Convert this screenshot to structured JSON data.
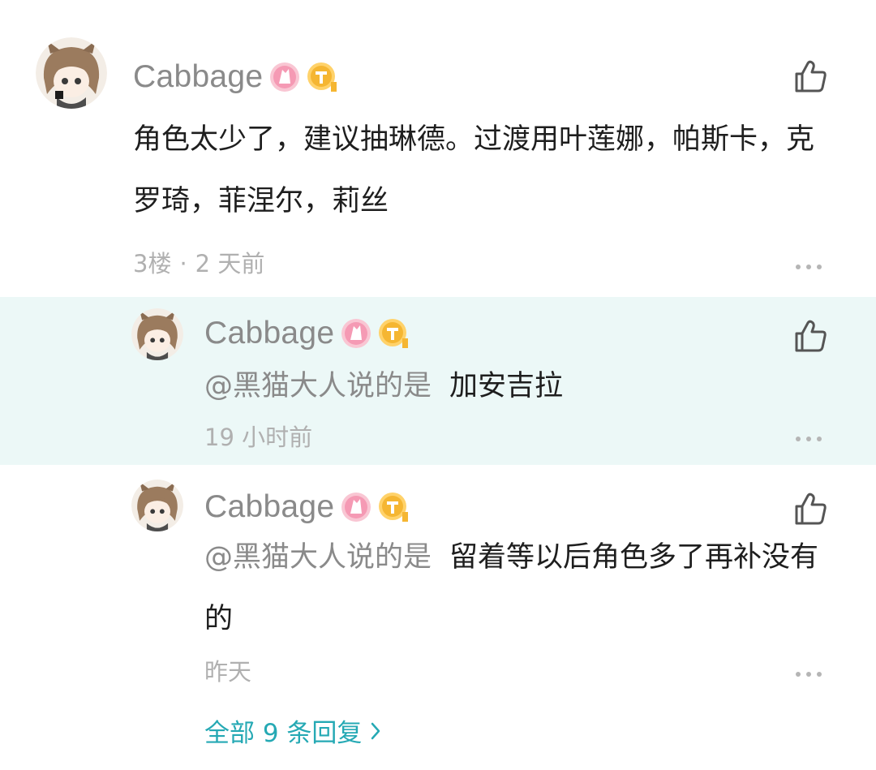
{
  "comments": [
    {
      "username": "Cabbage",
      "content": "角色太少了，建议抽琳德。过渡用叶莲娜，帕斯卡，克罗琦，菲涅尔，莉丝",
      "floor": "3楼",
      "separator": "·",
      "time": "2 天前",
      "badges": [
        "anniversary-badge-icon",
        "t1-level-badge-icon"
      ]
    },
    {
      "username": "Cabbage",
      "mention": "@黑猫大人说的是",
      "content": "加安吉拉",
      "time": "19 小时前",
      "highlighted": true
    },
    {
      "username": "Cabbage",
      "mention": "@黑猫大人说的是",
      "content": "留着等以后角色多了再补没有的",
      "time": "昨天"
    }
  ],
  "view_all_replies": "全部 9 条回复",
  "colors": {
    "highlight_bg": "#ecf8f7",
    "accent": "#25a9b4",
    "username": "#8a8a8a",
    "meta": "#b0b0b0"
  },
  "icons": {
    "like": "thumbs-up-icon",
    "more": "more-dots-icon",
    "chevron": "chevron-right-icon"
  }
}
